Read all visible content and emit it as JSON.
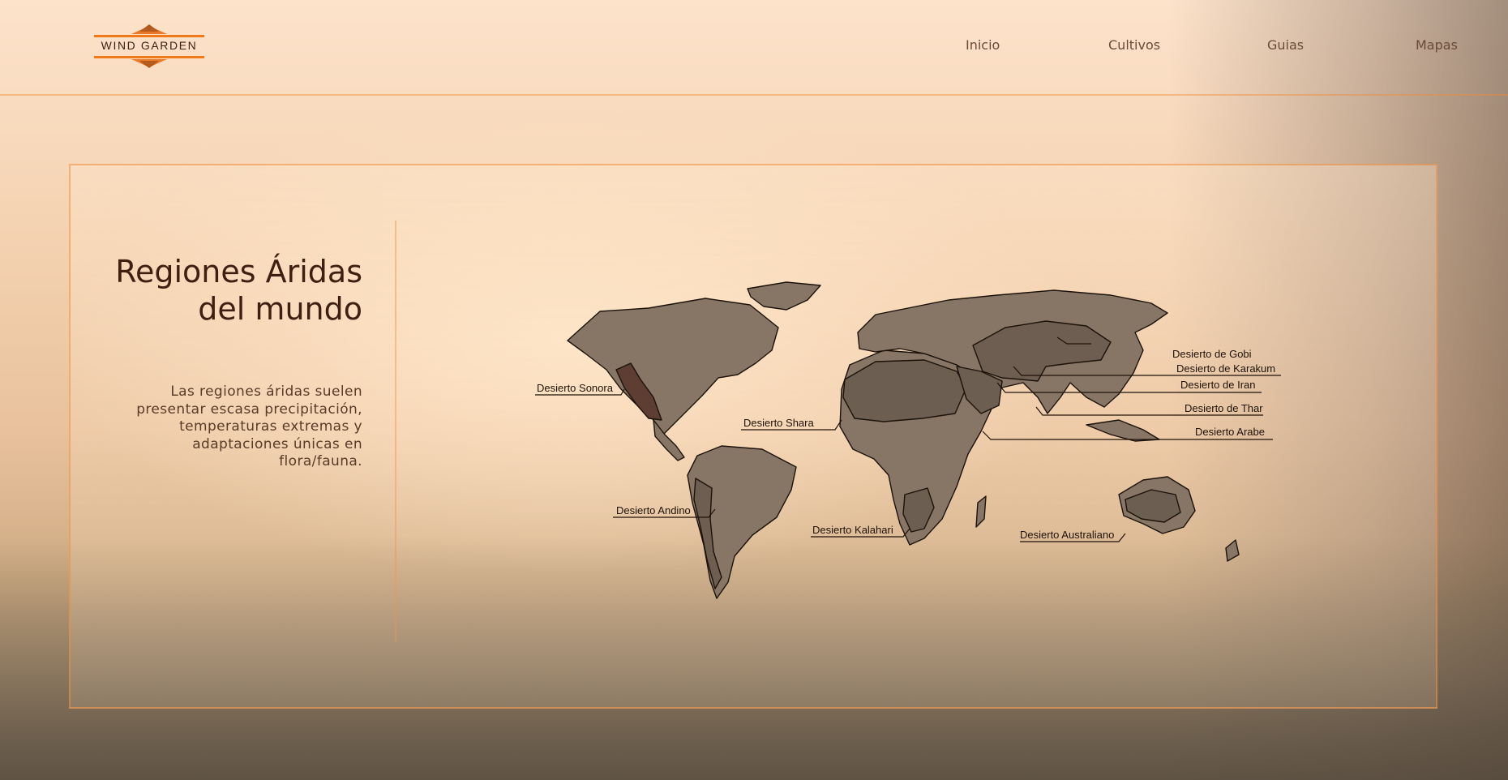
{
  "brand": {
    "name": "WIND GARDEN"
  },
  "nav": {
    "items": [
      "Inicio",
      "Cultivos",
      "Guias",
      "Mapas"
    ]
  },
  "hero": {
    "title_line1": "Regiones Áridas",
    "title_line2": "del mundo",
    "description": "Las regiones áridas suelen presentar escasa precipitación, temperaturas extremas y adaptaciones únicas en flora/fauna."
  },
  "map": {
    "labels": {
      "sonora": "Desierto Sonora",
      "shara": "Desierto Shara",
      "andino": "Desierto Andino",
      "kalahari": "Desierto Kalahari",
      "australiano": "Desierto Australiano",
      "gobi": "Desierto de Gobi",
      "karakum": "Desierto de Karakum",
      "iran": "Desierto de Iran",
      "thar": "Desierto de Thar",
      "arabe": "Desierto Arabe"
    }
  },
  "colors": {
    "accent": "#f07a1a",
    "title": "#3e1f12",
    "land": "#8a7a6c",
    "desert": "#6e5e52"
  }
}
